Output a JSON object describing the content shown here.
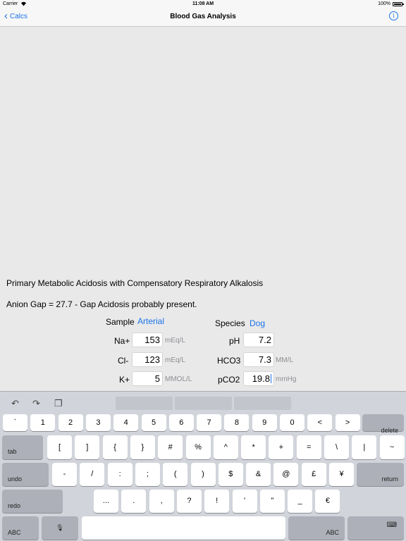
{
  "status_bar": {
    "carrier": "Carrier",
    "time": "11:08 AM",
    "battery": "100%"
  },
  "nav": {
    "back_label": "Calcs",
    "title": "Blood Gas Analysis",
    "info_glyph": "i"
  },
  "results": {
    "diagnosis": "Primary Metabolic Acidosis with Compensatory Respiratory Alkalosis",
    "anion_gap": "Anion Gap = 27.7 - Gap Acidosis probably present."
  },
  "sample": {
    "label": "Sample",
    "value": "Arterial"
  },
  "species": {
    "label": "Species",
    "value": "Dog"
  },
  "fields": {
    "na": {
      "label": "Na+",
      "value": "153",
      "unit": "mEq/L"
    },
    "cl": {
      "label": "Cl-",
      "value": "123",
      "unit": "mEq/L"
    },
    "k": {
      "label": "K+",
      "value": "5",
      "unit": "MMOL/L"
    },
    "ph": {
      "label": "pH",
      "value": "7.2",
      "unit": ""
    },
    "hco3": {
      "label": "HCO3",
      "value": "7.3",
      "unit": "MM/L"
    },
    "pco2": {
      "label": "pCO2",
      "value": "19.8",
      "unit": "mmHg"
    }
  },
  "keyboard": {
    "toolbar": {
      "undo": "↶",
      "redo": "↷",
      "paste": "❐"
    },
    "row1": [
      "`",
      "1",
      "2",
      "3",
      "4",
      "5",
      "6",
      "7",
      "8",
      "9",
      "0",
      "<",
      ">"
    ],
    "row1_end": "delete",
    "row2_start": "tab",
    "row2": [
      "[",
      "]",
      "{",
      "}",
      "#",
      "%",
      "^",
      "*",
      "+",
      "=",
      "\\",
      "|",
      "~"
    ],
    "row3_start": "undo",
    "row3": [
      "-",
      "/",
      ":",
      ";",
      "(",
      ")",
      "$",
      "&",
      "@",
      "£",
      "¥"
    ],
    "row3_end": "return",
    "row4_start": "redo",
    "row4": [
      "...",
      ".",
      ",",
      "?",
      "!",
      "'",
      "\"",
      "_",
      "€"
    ],
    "row5_left": "ABC",
    "row5_mic": "🎙",
    "row5_right": "ABC",
    "row5_hide": "⌨"
  }
}
